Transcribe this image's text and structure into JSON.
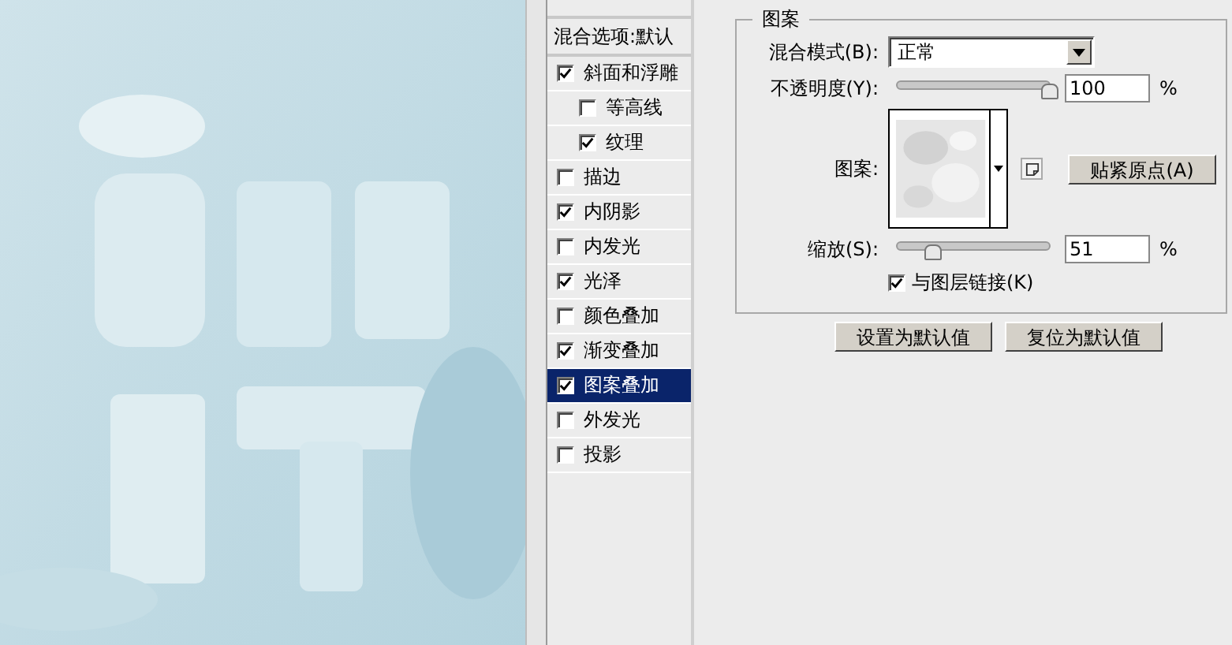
{
  "styles_panel": {
    "blend_options": "混合选项:默认",
    "items": [
      {
        "label": "斜面和浮雕",
        "checked": true,
        "selected": false,
        "children": [
          {
            "label": "等高线",
            "checked": false,
            "selected": false
          },
          {
            "label": "纹理",
            "checked": true,
            "selected": false
          }
        ]
      },
      {
        "label": "描边",
        "checked": false,
        "selected": false
      },
      {
        "label": "内阴影",
        "checked": true,
        "selected": false
      },
      {
        "label": "内发光",
        "checked": false,
        "selected": false
      },
      {
        "label": "光泽",
        "checked": true,
        "selected": false
      },
      {
        "label": "颜色叠加",
        "checked": false,
        "selected": false
      },
      {
        "label": "渐变叠加",
        "checked": true,
        "selected": false
      },
      {
        "label": "图案叠加",
        "checked": true,
        "selected": true
      },
      {
        "label": "外发光",
        "checked": false,
        "selected": false
      },
      {
        "label": "投影",
        "checked": false,
        "selected": false
      }
    ]
  },
  "pattern_group": {
    "title": "图案",
    "blend_mode": {
      "label": "混合模式(B):",
      "value": "正常"
    },
    "opacity": {
      "label": "不透明度(Y):",
      "level": 1,
      "value": "100",
      "unit": "%"
    },
    "pattern": {
      "label": "图案:",
      "snap_button": "贴紧原点(A)"
    },
    "scale": {
      "label": "缩放(S):",
      "level": 0.24,
      "value": "51",
      "unit": "%"
    },
    "link": {
      "label": "与图层链接(K)",
      "checked": true
    }
  },
  "buttons": [
    "设置为默认值",
    "复位为默认值"
  ]
}
